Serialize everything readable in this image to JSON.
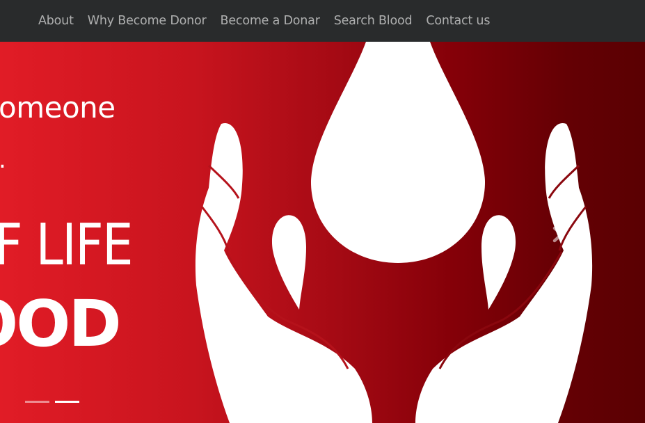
{
  "navbar": {
    "links": [
      {
        "label": "About"
      },
      {
        "label": "Why Become Donor"
      },
      {
        "label": "Become a Donar"
      },
      {
        "label": "Search Blood"
      },
      {
        "label": "Contact us"
      }
    ]
  },
  "carousel": {
    "slide_text": {
      "line1": "omeone",
      "line2": ".",
      "line3": "F LIFE",
      "line4": "OOD"
    },
    "next_icon": "chevron-right-icon",
    "indicators": [
      {
        "active": false
      },
      {
        "active": true
      }
    ],
    "colors": {
      "gradient_start": "#e11c26",
      "gradient_end": "#5a0002",
      "artwork": "#ffffff"
    }
  }
}
